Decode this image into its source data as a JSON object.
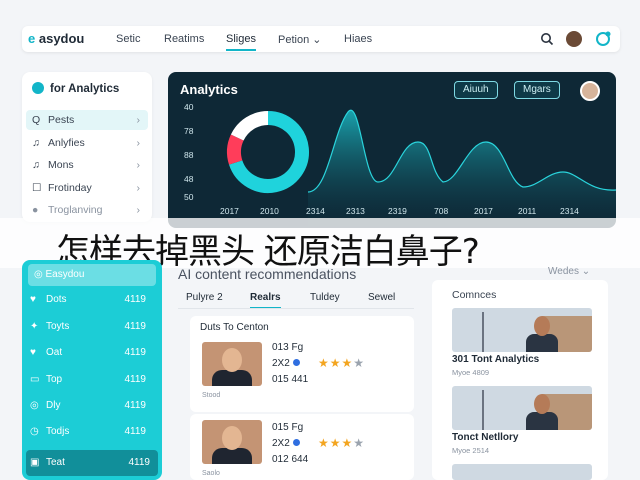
{
  "topbar": {
    "brand_mark": "e",
    "brand_name": "asydou",
    "nav": [
      "Setic",
      "Reatims",
      "Sliges",
      "Petion",
      "Hiaes"
    ],
    "petion_chevron": "⌄"
  },
  "side_panel": {
    "title": "for Analytics",
    "items": [
      {
        "icon": "search-icon",
        "glyph": "Q",
        "label": "Pests"
      },
      {
        "icon": "music-note-icon",
        "glyph": "♫",
        "label": "Anlyfies"
      },
      {
        "icon": "music-note-icon",
        "glyph": "♫",
        "label": "Mons"
      },
      {
        "icon": "square-icon",
        "glyph": "☐",
        "label": "Frotinday"
      },
      {
        "icon": "circle-icon",
        "glyph": "●",
        "label": "Troglanving"
      }
    ]
  },
  "hero": {
    "title": "Analytics",
    "button_1": "Aiuuh",
    "button_2": "Mgars",
    "y_labels": [
      "40",
      "78",
      "88",
      "48",
      "50"
    ],
    "x_labels": [
      "2017",
      "2010",
      "2314",
      "2313",
      "2319",
      "708",
      "2017",
      "2011",
      "2314"
    ]
  },
  "chart_data": {
    "type": "area",
    "title": "Analytics",
    "x": [
      "2017",
      "2010",
      "2314",
      "2313",
      "2319",
      "708",
      "2017",
      "2011",
      "2314"
    ],
    "y_ticks": [
      "40",
      "78",
      "88",
      "48",
      "50"
    ],
    "grid": false,
    "donut": {
      "segments": [
        0.7,
        0.12,
        0.18
      ],
      "colors": [
        "#1fd3dc",
        "#ff3d5a",
        "#ffffff"
      ]
    },
    "accent": "#17aeb8"
  },
  "caption": {
    "text": "怎样去掉黑头 还原洁白鼻子?"
  },
  "left_teal": {
    "header": "Easydou",
    "items": [
      {
        "icon": "heart-icon",
        "glyph": "♥",
        "label": "Dots",
        "value": "4119"
      },
      {
        "icon": "pin-icon",
        "glyph": "✦",
        "label": "Toyts",
        "value": "4119"
      },
      {
        "icon": "heart-icon",
        "glyph": "♥",
        "label": "Oat",
        "value": "4119"
      },
      {
        "icon": "screen-icon",
        "glyph": "▭",
        "label": "Top",
        "value": "4119"
      },
      {
        "icon": "circle-icon",
        "glyph": "◎",
        "label": "Dly",
        "value": "4119"
      },
      {
        "icon": "clock-icon",
        "glyph": "◷",
        "label": "Todjs",
        "value": "4119"
      },
      {
        "icon": "screen-icon",
        "glyph": "▣",
        "label": "Teat",
        "value": "4119"
      }
    ]
  },
  "main": {
    "section_title": "AI content recommendations",
    "sort_label": "Wedes",
    "tabs": [
      "Pulyre 2",
      "Realrs",
      "Tuldey",
      "Sewel"
    ],
    "card_header": "Duts To Centon",
    "cards": [
      {
        "line1": "013 Fg",
        "line2": "2X2",
        "line3": "015 441",
        "rating_on": "★★★",
        "rating_off": "★",
        "foot": "Stood"
      },
      {
        "line1": "015 Fg",
        "line2": "2X2",
        "line3": "012 644",
        "rating_on": "★★★",
        "rating_off": "★",
        "foot": "Saolo"
      }
    ]
  },
  "right_panel": {
    "title": "Comnces",
    "items": [
      {
        "name": "301 Tont Analytics",
        "sub": "Myoe 4809"
      },
      {
        "name": "Tonct Netllory",
        "sub": "Myoe 2514"
      }
    ]
  },
  "colors": {
    "accent": "#12b5c8",
    "hero_bg": "#0e2836",
    "teal_panel": "#1ccdd6",
    "star": "#f3a520"
  }
}
